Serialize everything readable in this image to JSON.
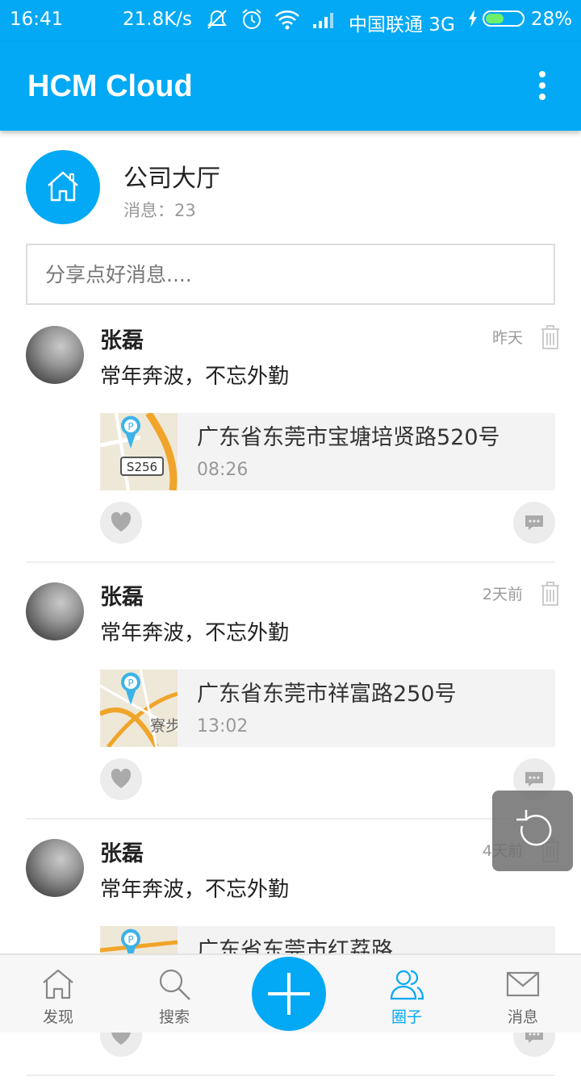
{
  "status_bar": {
    "time": "16:41",
    "speed": "21.8K/s",
    "carrier": "中国联通 3G",
    "battery": "28%",
    "battery_level": 0.28
  },
  "app_bar": {
    "title": "HCM Cloud",
    "menu_icon": "more-vert-icon"
  },
  "group": {
    "icon": "home-icon",
    "name": "公司大厅",
    "message_count": "消息：23"
  },
  "share_box": {
    "placeholder": "分享点好消息...."
  },
  "posts": [
    {
      "author": "张磊",
      "time": "昨天",
      "content": "常年奔波，不忘外勤",
      "location": {
        "address": "广东省东莞市宝塘培贤路520号",
        "time": "08:26",
        "map_label": "S256"
      }
    },
    {
      "author": "张磊",
      "time": "2天前",
      "content": "常年奔波，不忘外勤",
      "location": {
        "address": "广东省东莞市祥富路250号",
        "time": "13:02",
        "map_label": "寮步"
      }
    },
    {
      "author": "张磊",
      "time": "4天前",
      "content": "常年奔波，不忘外勤",
      "location": {
        "address": "广东省东莞市红荔路",
        "time": "",
        "map_label": ""
      }
    }
  ],
  "bottom_nav": {
    "items": [
      {
        "label": "发现",
        "icon": "home-icon"
      },
      {
        "label": "搜索",
        "icon": "search-icon"
      },
      {
        "label": "圈子",
        "icon": "people-icon",
        "active": true
      },
      {
        "label": "消息",
        "icon": "mail-icon"
      }
    ],
    "add_icon": "plus-icon"
  },
  "colors": {
    "primary": "#03a9f4",
    "card_bg": "#f3f3f3",
    "muted_text": "#999999"
  }
}
